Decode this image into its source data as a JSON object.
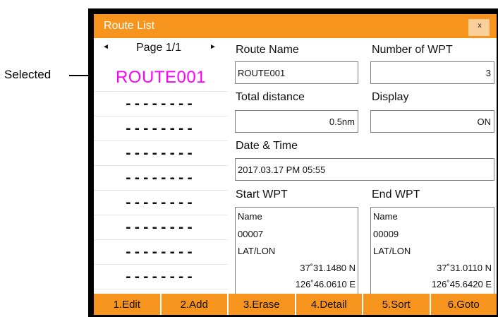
{
  "annotation": {
    "label": "Selected"
  },
  "window": {
    "title": "Route List",
    "close_label": "x"
  },
  "list": {
    "pager": {
      "prev_icon": "◄",
      "label": "Page 1/1",
      "next_icon": "►"
    },
    "routes": [
      {
        "name": "ROUTE001",
        "selected": true
      },
      {
        "name": "--------"
      },
      {
        "name": "--------"
      },
      {
        "name": "--------"
      },
      {
        "name": "--------"
      },
      {
        "name": "--------"
      },
      {
        "name": "--------"
      },
      {
        "name": "--------"
      },
      {
        "name": "--------"
      }
    ]
  },
  "detail": {
    "route_name": {
      "label": "Route Name",
      "value": "ROUTE001"
    },
    "num_wpt": {
      "label": "Number of WPT",
      "value": "3"
    },
    "total_distance": {
      "label": "Total distance",
      "value": "0.5nm"
    },
    "display": {
      "label": "Display",
      "value": "ON"
    },
    "datetime": {
      "label": "Date & Time",
      "value": "2017.03.17 PM 05:55"
    },
    "start_wpt": {
      "label": "Start WPT",
      "name_label": "Name",
      "name": "00007",
      "latlon_label": "LAT/LON",
      "lat": "37˚31.1480 N",
      "lon": "126˚46.0610 E"
    },
    "end_wpt": {
      "label": "End WPT",
      "name_label": "Name",
      "name": "00009",
      "latlon_label": "LAT/LON",
      "lat": "37˚31.0110 N",
      "lon": "126˚45.6420 E"
    }
  },
  "footer": {
    "buttons": [
      "1.Edit",
      "2.Add",
      "3.Erase",
      "4.Detail",
      "5.Sort",
      "6.Goto"
    ]
  },
  "colors": {
    "accent": "#F7941D",
    "selected": "#FF00FF"
  }
}
